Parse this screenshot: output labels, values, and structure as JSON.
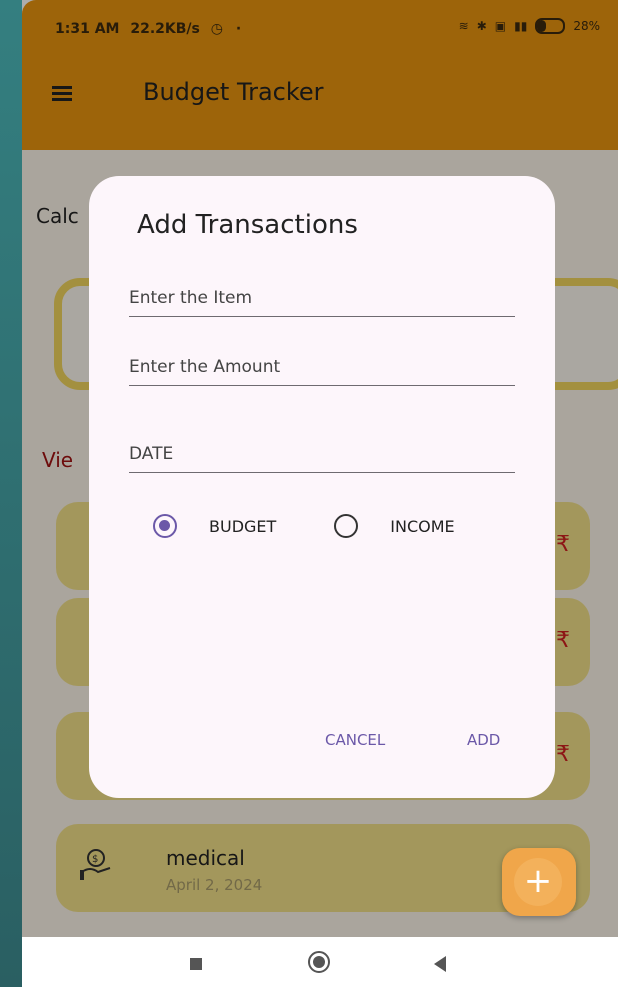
{
  "status_bar": {
    "time": "1:31 AM",
    "speed": "22.2KB/s",
    "battery": "28%"
  },
  "app_bar": {
    "title": "Budget Tracker"
  },
  "background": {
    "calculate_label": "Calc",
    "view_label": "Vie",
    "transaction": {
      "name": "medical",
      "date": "April 2, 2024",
      "currency": "₹"
    }
  },
  "dialog": {
    "title": "Add Transactions",
    "item_placeholder": "Enter the Item",
    "amount_placeholder": "Enter the Amount",
    "date_placeholder": "DATE",
    "radio_budget": "BUDGET",
    "radio_income": "INCOME",
    "cancel": "CANCEL",
    "add": "ADD"
  },
  "fab": {
    "icon": "plus-icon",
    "symbol": "+"
  },
  "colors": {
    "appbar": "#e89410",
    "accent": "#6b58a8",
    "card": "#f1df88",
    "dialog": "#fdf6fb"
  }
}
